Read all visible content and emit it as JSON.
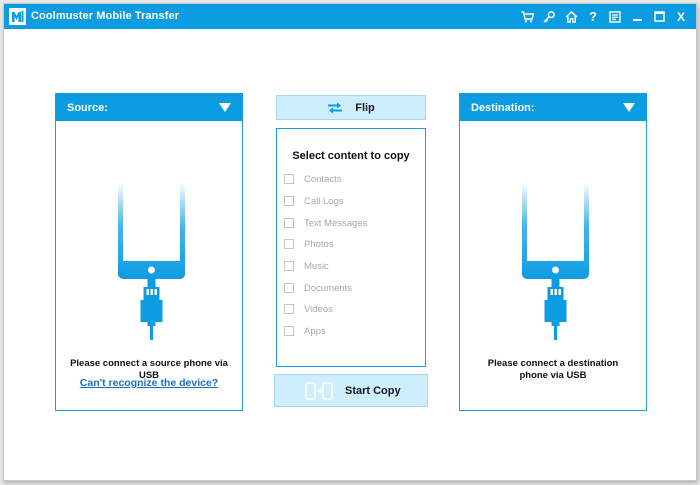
{
  "window": {
    "title": "Coolmuster Mobile Transfer",
    "accent": "#0c9ce2",
    "toolbar_icons": [
      "cart-icon",
      "key-icon",
      "home-icon",
      "help-icon",
      "feedback-icon",
      "minimize-icon",
      "maximize-icon",
      "close-icon"
    ],
    "help_glyph": "?",
    "close_glyph": "X"
  },
  "source": {
    "label": "Source:",
    "message": "Please connect a source phone via USB",
    "link": "Can't recognize the device?"
  },
  "destination": {
    "label": "Destination:",
    "message": "Please connect a destination phone via USB"
  },
  "flip": {
    "label": "Flip"
  },
  "content": {
    "title": "Select content to copy",
    "options": [
      "Contacts",
      "Call Logs",
      "Text Messages",
      "Photos",
      "Music",
      "Documents",
      "Videos",
      "Apps"
    ]
  },
  "start": {
    "label": "Start Copy"
  }
}
